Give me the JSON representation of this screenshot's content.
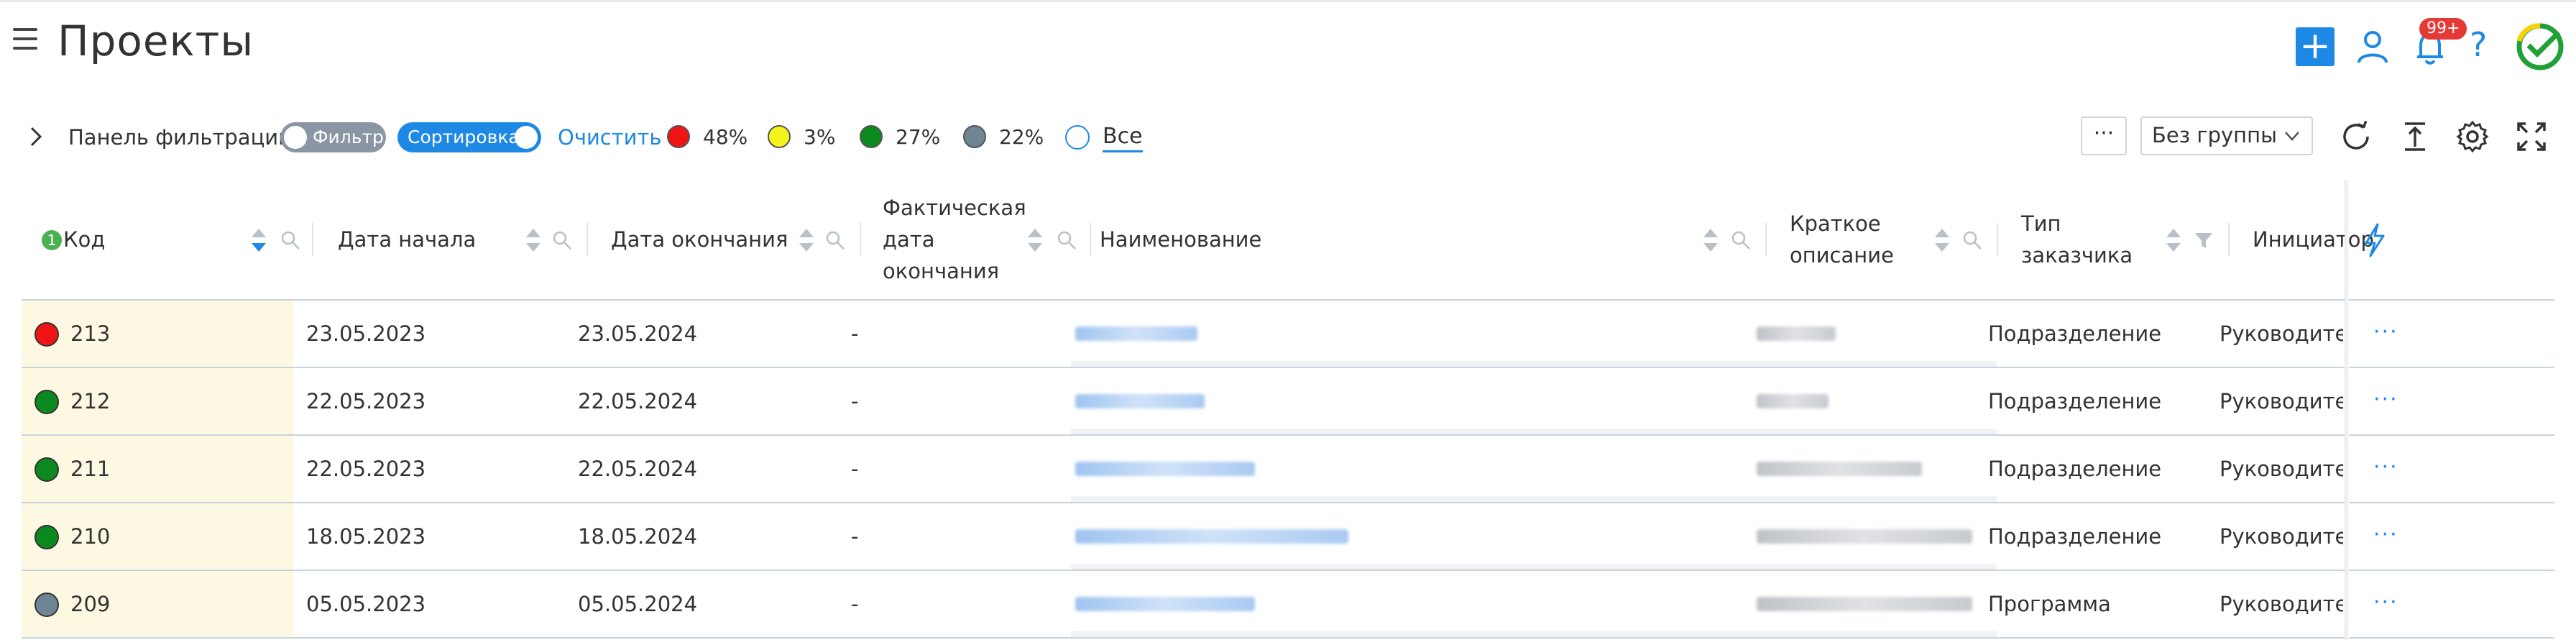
{
  "page": {
    "title": "Проекты"
  },
  "header": {
    "notifications_badge": "99+",
    "help_label": "?",
    "add_label": "+"
  },
  "toolbar": {
    "filter_panel_label": "Панель фильтрации",
    "filter_toggle_label": "Фильтр",
    "sort_toggle_label": "Сортировка",
    "clear_label": "Очистить",
    "stats": [
      {
        "color": "#f01414",
        "value": "48%",
        "name": "red"
      },
      {
        "color": "#f5f51e",
        "value": "3%",
        "name": "yellow"
      },
      {
        "color": "#0a8a1e",
        "value": "27%",
        "name": "green"
      },
      {
        "color": "#6e8596",
        "value": "22%",
        "name": "gray"
      }
    ],
    "all_label": "Все",
    "more_label": "···",
    "group_select_value": "Без группы"
  },
  "table": {
    "columns": {
      "code": "Код",
      "code_badge": "1",
      "start_date": "Дата начала",
      "end_date": "Дата окончания",
      "actual_end": "Фактическая\nдата\nокончания",
      "name": "Наименование",
      "short_desc": "Краткое\nописание",
      "customer_type": "Тип\nзаказчика",
      "initiator": "Инициатор"
    },
    "rows": [
      {
        "status": "#f01414",
        "code": "213",
        "start": "23.05.2023",
        "end": "23.05.2024",
        "actual": "-",
        "customer_type": "Подразделение",
        "initiator": "Руководител",
        "actions": "···"
      },
      {
        "status": "#0a8a1e",
        "code": "212",
        "start": "22.05.2023",
        "end": "22.05.2024",
        "actual": "-",
        "customer_type": "Подразделение",
        "initiator": "Руководител",
        "actions": "···"
      },
      {
        "status": "#0a8a1e",
        "code": "211",
        "start": "22.05.2023",
        "end": "22.05.2024",
        "actual": "-",
        "customer_type": "Подразделение",
        "initiator": "Руководител",
        "actions": "···"
      },
      {
        "status": "#0a8a1e",
        "code": "210",
        "start": "18.05.2023",
        "end": "18.05.2024",
        "actual": "-",
        "customer_type": "Подразделение",
        "initiator": "Руководител",
        "actions": "···"
      },
      {
        "status": "#6e8596",
        "code": "209",
        "start": "05.05.2023",
        "end": "05.05.2024",
        "actual": "-",
        "customer_type": "Программа",
        "initiator": "Руководител",
        "actions": "···"
      }
    ]
  }
}
